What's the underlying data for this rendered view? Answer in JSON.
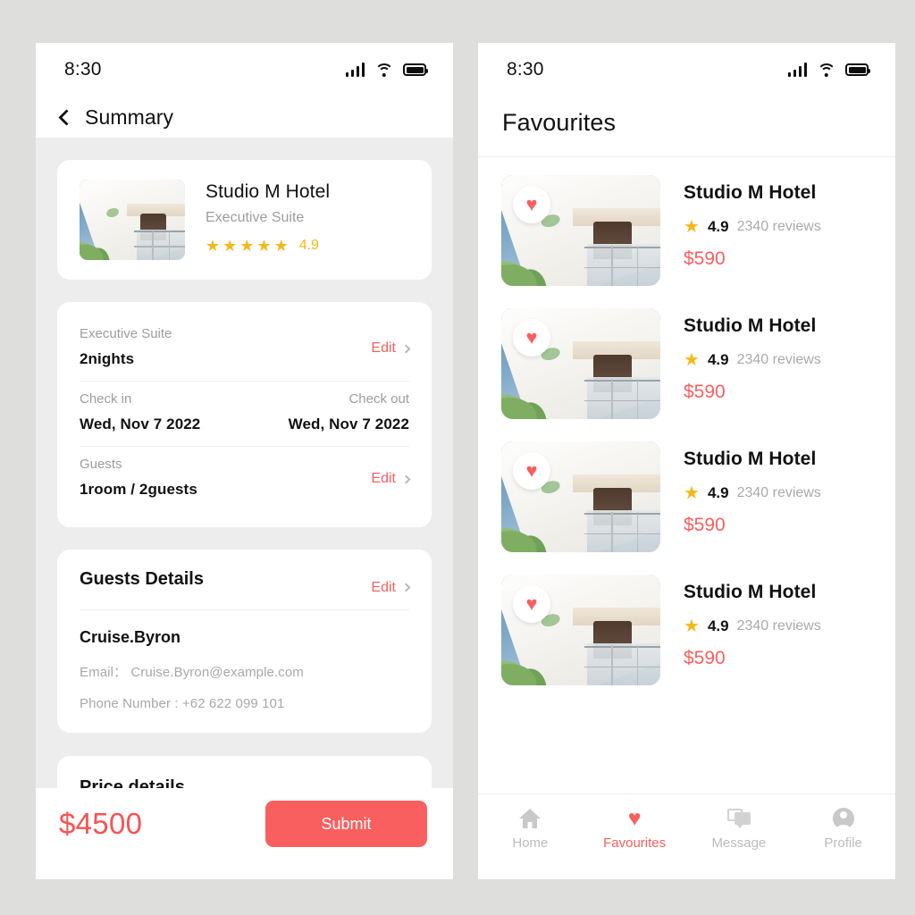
{
  "theme": {
    "accent_red": "#FA5F5F",
    "star_gold": "#F5B818",
    "page_bg": "#DEDEDC",
    "screen_bg": "#EDEDED"
  },
  "left_screen": {
    "status_bar": {
      "time": "8:30",
      "signal_icon": "signal-bars-icon",
      "wifi_icon": "wifi-icon",
      "battery_icon": "battery-icon"
    },
    "nav": {
      "back_icon": "back-chevron-icon",
      "title": "Summary"
    },
    "hotel_card": {
      "image_alt": "hotel-thumbnail",
      "name": "Studio M Hotel",
      "room_type": "Executive Suite",
      "stars": "★★★★★",
      "rating": "4.9"
    },
    "booking_card": {
      "room": {
        "label": "Executive Suite",
        "value": "2nights",
        "edit_label": "Edit"
      },
      "check_in": {
        "label": "Check in",
        "value": "Wed, Nov 7 2022"
      },
      "check_out": {
        "label": "Check out",
        "value": "Wed, Nov 7 2022"
      },
      "guests": {
        "label": "Guests",
        "value": "1room / 2guests",
        "edit_label": "Edit"
      }
    },
    "guests_card": {
      "title": "Guests Details",
      "edit_label": "Edit",
      "name": "Cruise.Byron",
      "email": "Email：  Cruise.Byron@example.com",
      "phone": "Phone Number : +62 622 099 101"
    },
    "price_card": {
      "title": "Price details"
    },
    "action_bar": {
      "total": "$4500",
      "submit_label": "Submit"
    }
  },
  "right_screen": {
    "status_bar": {
      "time": "8:30",
      "signal_icon": "signal-bars-icon",
      "wifi_icon": "wifi-icon",
      "battery_icon": "battery-icon"
    },
    "header": {
      "title": "Favourites"
    },
    "favourites": [
      {
        "name": "Studio M Hotel",
        "star": "★",
        "rating": "4.9",
        "reviews": "2340 reviews",
        "price": "$590",
        "favourite_icon": "heart-icon"
      },
      {
        "name": "Studio M Hotel",
        "star": "★",
        "rating": "4.9",
        "reviews": "2340 reviews",
        "price": "$590",
        "favourite_icon": "heart-icon"
      },
      {
        "name": "Studio M Hotel",
        "star": "★",
        "rating": "4.9",
        "reviews": "2340 reviews",
        "price": "$590",
        "favourite_icon": "heart-icon"
      },
      {
        "name": "Studio M Hotel",
        "star": "★",
        "rating": "4.9",
        "reviews": "2340 reviews",
        "price": "$590",
        "favourite_icon": "heart-icon"
      }
    ],
    "tab_bar": [
      {
        "label": "Home",
        "icon": "home-icon",
        "active": false
      },
      {
        "label": "Favourites",
        "icon": "heart-icon",
        "active": true
      },
      {
        "label": "Message",
        "icon": "message-icon",
        "active": false
      },
      {
        "label": "Profile",
        "icon": "profile-icon",
        "active": false
      }
    ]
  }
}
